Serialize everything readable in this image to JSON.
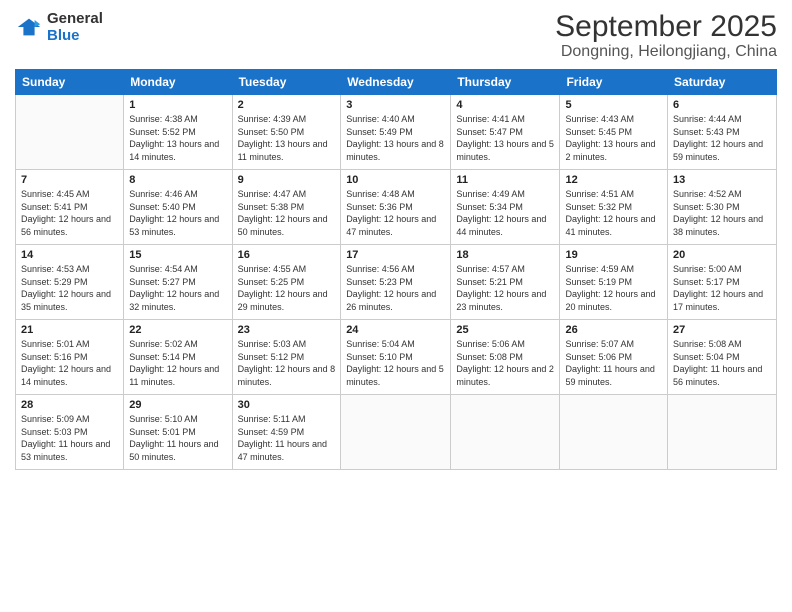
{
  "logo": {
    "line1": "General",
    "line2": "Blue"
  },
  "title": "September 2025",
  "subtitle": "Dongning, Heilongjiang, China",
  "header_days": [
    "Sunday",
    "Monday",
    "Tuesday",
    "Wednesday",
    "Thursday",
    "Friday",
    "Saturday"
  ],
  "weeks": [
    [
      {
        "day": "",
        "sunrise": "",
        "sunset": "",
        "daylight": ""
      },
      {
        "day": "1",
        "sunrise": "Sunrise: 4:38 AM",
        "sunset": "Sunset: 5:52 PM",
        "daylight": "Daylight: 13 hours and 14 minutes."
      },
      {
        "day": "2",
        "sunrise": "Sunrise: 4:39 AM",
        "sunset": "Sunset: 5:50 PM",
        "daylight": "Daylight: 13 hours and 11 minutes."
      },
      {
        "day": "3",
        "sunrise": "Sunrise: 4:40 AM",
        "sunset": "Sunset: 5:49 PM",
        "daylight": "Daylight: 13 hours and 8 minutes."
      },
      {
        "day": "4",
        "sunrise": "Sunrise: 4:41 AM",
        "sunset": "Sunset: 5:47 PM",
        "daylight": "Daylight: 13 hours and 5 minutes."
      },
      {
        "day": "5",
        "sunrise": "Sunrise: 4:43 AM",
        "sunset": "Sunset: 5:45 PM",
        "daylight": "Daylight: 13 hours and 2 minutes."
      },
      {
        "day": "6",
        "sunrise": "Sunrise: 4:44 AM",
        "sunset": "Sunset: 5:43 PM",
        "daylight": "Daylight: 12 hours and 59 minutes."
      }
    ],
    [
      {
        "day": "7",
        "sunrise": "Sunrise: 4:45 AM",
        "sunset": "Sunset: 5:41 PM",
        "daylight": "Daylight: 12 hours and 56 minutes."
      },
      {
        "day": "8",
        "sunrise": "Sunrise: 4:46 AM",
        "sunset": "Sunset: 5:40 PM",
        "daylight": "Daylight: 12 hours and 53 minutes."
      },
      {
        "day": "9",
        "sunrise": "Sunrise: 4:47 AM",
        "sunset": "Sunset: 5:38 PM",
        "daylight": "Daylight: 12 hours and 50 minutes."
      },
      {
        "day": "10",
        "sunrise": "Sunrise: 4:48 AM",
        "sunset": "Sunset: 5:36 PM",
        "daylight": "Daylight: 12 hours and 47 minutes."
      },
      {
        "day": "11",
        "sunrise": "Sunrise: 4:49 AM",
        "sunset": "Sunset: 5:34 PM",
        "daylight": "Daylight: 12 hours and 44 minutes."
      },
      {
        "day": "12",
        "sunrise": "Sunrise: 4:51 AM",
        "sunset": "Sunset: 5:32 PM",
        "daylight": "Daylight: 12 hours and 41 minutes."
      },
      {
        "day": "13",
        "sunrise": "Sunrise: 4:52 AM",
        "sunset": "Sunset: 5:30 PM",
        "daylight": "Daylight: 12 hours and 38 minutes."
      }
    ],
    [
      {
        "day": "14",
        "sunrise": "Sunrise: 4:53 AM",
        "sunset": "Sunset: 5:29 PM",
        "daylight": "Daylight: 12 hours and 35 minutes."
      },
      {
        "day": "15",
        "sunrise": "Sunrise: 4:54 AM",
        "sunset": "Sunset: 5:27 PM",
        "daylight": "Daylight: 12 hours and 32 minutes."
      },
      {
        "day": "16",
        "sunrise": "Sunrise: 4:55 AM",
        "sunset": "Sunset: 5:25 PM",
        "daylight": "Daylight: 12 hours and 29 minutes."
      },
      {
        "day": "17",
        "sunrise": "Sunrise: 4:56 AM",
        "sunset": "Sunset: 5:23 PM",
        "daylight": "Daylight: 12 hours and 26 minutes."
      },
      {
        "day": "18",
        "sunrise": "Sunrise: 4:57 AM",
        "sunset": "Sunset: 5:21 PM",
        "daylight": "Daylight: 12 hours and 23 minutes."
      },
      {
        "day": "19",
        "sunrise": "Sunrise: 4:59 AM",
        "sunset": "Sunset: 5:19 PM",
        "daylight": "Daylight: 12 hours and 20 minutes."
      },
      {
        "day": "20",
        "sunrise": "Sunrise: 5:00 AM",
        "sunset": "Sunset: 5:17 PM",
        "daylight": "Daylight: 12 hours and 17 minutes."
      }
    ],
    [
      {
        "day": "21",
        "sunrise": "Sunrise: 5:01 AM",
        "sunset": "Sunset: 5:16 PM",
        "daylight": "Daylight: 12 hours and 14 minutes."
      },
      {
        "day": "22",
        "sunrise": "Sunrise: 5:02 AM",
        "sunset": "Sunset: 5:14 PM",
        "daylight": "Daylight: 12 hours and 11 minutes."
      },
      {
        "day": "23",
        "sunrise": "Sunrise: 5:03 AM",
        "sunset": "Sunset: 5:12 PM",
        "daylight": "Daylight: 12 hours and 8 minutes."
      },
      {
        "day": "24",
        "sunrise": "Sunrise: 5:04 AM",
        "sunset": "Sunset: 5:10 PM",
        "daylight": "Daylight: 12 hours and 5 minutes."
      },
      {
        "day": "25",
        "sunrise": "Sunrise: 5:06 AM",
        "sunset": "Sunset: 5:08 PM",
        "daylight": "Daylight: 12 hours and 2 minutes."
      },
      {
        "day": "26",
        "sunrise": "Sunrise: 5:07 AM",
        "sunset": "Sunset: 5:06 PM",
        "daylight": "Daylight: 11 hours and 59 minutes."
      },
      {
        "day": "27",
        "sunrise": "Sunrise: 5:08 AM",
        "sunset": "Sunset: 5:04 PM",
        "daylight": "Daylight: 11 hours and 56 minutes."
      }
    ],
    [
      {
        "day": "28",
        "sunrise": "Sunrise: 5:09 AM",
        "sunset": "Sunset: 5:03 PM",
        "daylight": "Daylight: 11 hours and 53 minutes."
      },
      {
        "day": "29",
        "sunrise": "Sunrise: 5:10 AM",
        "sunset": "Sunset: 5:01 PM",
        "daylight": "Daylight: 11 hours and 50 minutes."
      },
      {
        "day": "30",
        "sunrise": "Sunrise: 5:11 AM",
        "sunset": "Sunset: 4:59 PM",
        "daylight": "Daylight: 11 hours and 47 minutes."
      },
      {
        "day": "",
        "sunrise": "",
        "sunset": "",
        "daylight": ""
      },
      {
        "day": "",
        "sunrise": "",
        "sunset": "",
        "daylight": ""
      },
      {
        "day": "",
        "sunrise": "",
        "sunset": "",
        "daylight": ""
      },
      {
        "day": "",
        "sunrise": "",
        "sunset": "",
        "daylight": ""
      }
    ]
  ]
}
